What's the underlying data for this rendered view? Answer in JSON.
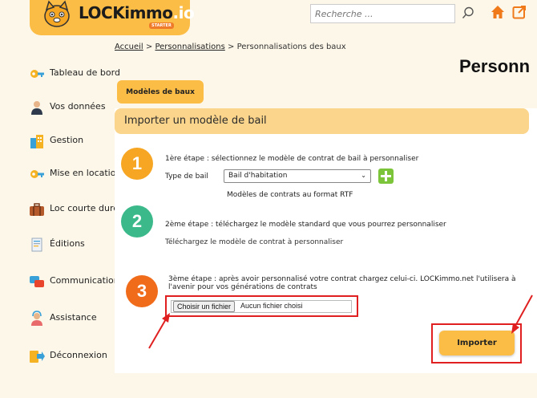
{
  "header": {
    "logo_text": "LOCKimmo",
    "logo_suffix": ".io",
    "logo_badge": "STARTER",
    "search_placeholder": "Recherche ..."
  },
  "breadcrumb": {
    "home": "Accueil",
    "sep1": " > ",
    "section": "Personnalisations",
    "sep2": " > ",
    "current": "Personnalisations des baux"
  },
  "page_title": "Personn",
  "sidebar": {
    "items": [
      {
        "label": "Tableau de bord",
        "icon": "key-icon"
      },
      {
        "label": "Vos données",
        "icon": "person-icon"
      },
      {
        "label": "Gestion",
        "icon": "building-icon"
      },
      {
        "label": "Mise en location",
        "icon": "key-icon"
      },
      {
        "label": "Loc courte durée",
        "icon": "suitcase-icon"
      },
      {
        "label": "Éditions",
        "icon": "document-icon"
      },
      {
        "label": "Communication",
        "icon": "chat-icon"
      },
      {
        "label": "Assistance",
        "icon": "support-icon"
      },
      {
        "label": "Déconnexion",
        "icon": "logout-icon"
      }
    ]
  },
  "main": {
    "tab_label": "Modèles de baux",
    "section_title": "Importer un modèle de bail",
    "step1": {
      "number": "1",
      "text": "1ère étape : sélectionnez le modèle de contrat de bail à personnaliser",
      "type_label": "Type de bail",
      "select_value": "Bail d'habitation",
      "note": "Modèles de contrats au format RTF"
    },
    "step2": {
      "number": "2",
      "text": "2ème étape : téléchargez le modèle standard que vous pourrez personnaliser",
      "link": "Téléchargez le modèle de contrat à personnaliser"
    },
    "step3": {
      "number": "3",
      "text_line1": "3ème étape : après avoir personnalisé votre contrat chargez celui-ci. LOCKimmo.net l'utilisera à",
      "text_line2": "l'avenir pour vos générations de contrats",
      "file_button": "Choisir un fichier",
      "file_status": "Aucun fichier choisi"
    },
    "import_button": "Importer"
  },
  "colors": {
    "accent": "#fbbd46",
    "section_bar": "#fbd58c",
    "highlight": "#e02020",
    "step1": "#f6a623",
    "step2": "#3cb98b",
    "step3": "#f06b1a"
  }
}
